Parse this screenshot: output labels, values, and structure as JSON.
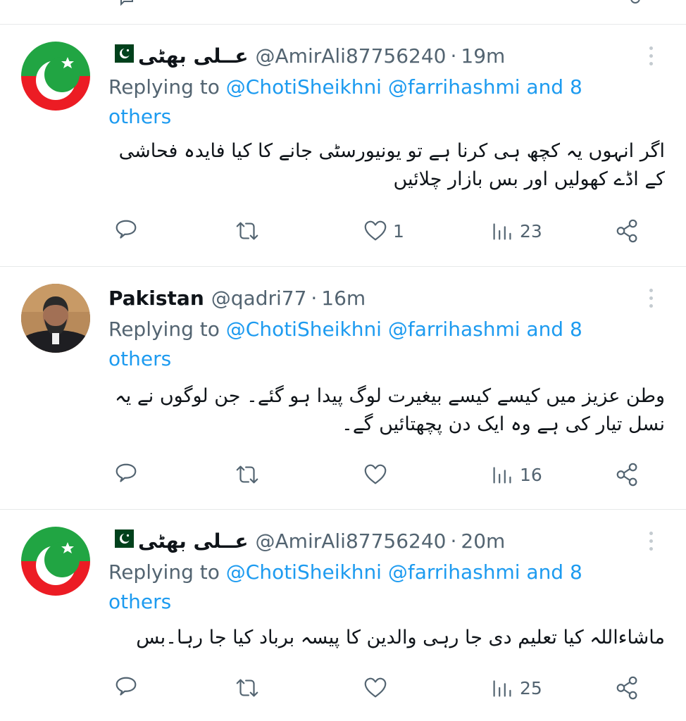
{
  "tweets": [
    {
      "name": "عــلی بھٹی",
      "flag": "🇵🇰",
      "handle": "@AmirAli87756240",
      "dot": "·",
      "time": "19m",
      "replying_prefix": "Replying to ",
      "mention1": "@ChotiSheikhni",
      "mention2": "@farrihashmi",
      "and_others": "and 8 others",
      "text": "اگر انہوں یہ کچھ ہی کرنا ہے تو یونیورسٹی جانے کا کیا فایدہ فحاشی کے اڈے کھولیں اور بس بازار چلائیں",
      "likes": "1",
      "views": "23"
    },
    {
      "name": "Pakistan",
      "handle": "@qadri77",
      "dot": "·",
      "time": "16m",
      "replying_prefix": "Replying to ",
      "mention1": "@ChotiSheikhni",
      "mention2": "@farrihashmi",
      "and_others": "and 8 others",
      "text": "وطن عزیز میں کیسے کیسے بیغیرت لوگ پیدا ہو گئے۔ جن لوگوں نے یہ نسل تیار کی ہے وہ ایک دن پچھتائیں گے۔",
      "likes": "",
      "views": "16"
    },
    {
      "name": "عــلی بھٹی",
      "flag": "🇵🇰",
      "handle": "@AmirAli87756240",
      "dot": "·",
      "time": "20m",
      "replying_prefix": "Replying to ",
      "mention1": "@ChotiSheikhni",
      "mention2": "@farrihashmi",
      "and_others": "and 8 others",
      "text": "ماشاءاللہ کیا تعلیم دی جا رہی والدین کا پیسہ برباد کیا جا رہا۔بس",
      "likes": "",
      "views": "25"
    }
  ],
  "icons": {
    "reply": "reply-icon",
    "retweet": "retweet-icon",
    "like": "heart-icon",
    "views": "views-icon",
    "share": "share-icon",
    "more": "more-icon"
  },
  "colors": {
    "link": "#1d9bf0",
    "secondary_text": "#536471",
    "avatar_red": "#ec1c24",
    "avatar_green": "#21a543"
  }
}
